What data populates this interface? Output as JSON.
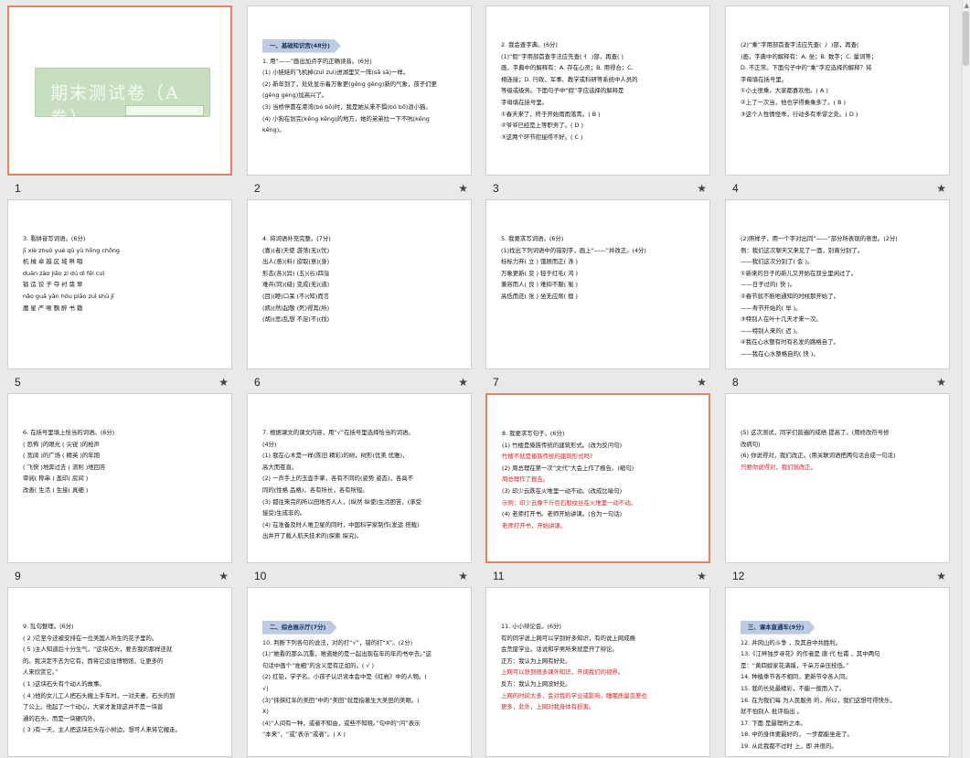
{
  "slides": [
    {
      "num": "1",
      "selected": true,
      "title_text": "期末测试卷（A卷）",
      "lines": []
    },
    {
      "num": "2",
      "header": "一、基础知识宫(48分)",
      "lines": [
        {
          "t": "1. 用“——”画出加点字的正确读音。(6分)"
        },
        {
          "t": "(1) 小娃娃的飞机掉(zuì  zuì)进湖里又一阵(sǎ  sā)一样。"
        },
        {
          "t": "(2) 新年到了，处处显示着万象更(gēng  gèng)新的气象，孩子们更"
        },
        {
          "t": "(gēng  gèng)加高兴了。"
        },
        {
          "t": "(3) 当桥停靠在港湾(bó  bō)时，我是她从来不惧(bó  bō)浪小猫。"
        },
        {
          "t": "(4) 小狗在划完(kēng  kēng)的地方，她的弟弟拉一下不吭(kēng"
        },
        {
          "t": "kēng)。"
        }
      ]
    },
    {
      "num": "3",
      "lines": [
        {
          "t": "2. 我会查字典。(6分)"
        },
        {
          "t": "(1)“假”字用部首查字法应先查(  亻  )部，再查(         )"
        },
        {
          "t": "画，字典中的解释有：A. 存在心灵；B. 用得合；C."
        },
        {
          "t": "相连接；D. 行政、军事、教学或科研等系统中人员的"
        },
        {
          "t": "等级或级务。下面句子中“假”字应选择的解释是"
        },
        {
          "t": "字母填在括号里。"
        },
        {
          "t": "①春天来了，终于开始雨雨落青。(  B  )"
        },
        {
          "t": "②爷爷已经是上等职务了。(  D  )"
        },
        {
          "t": "③这两个环节衔接得不好。(  C  )"
        }
      ]
    },
    {
      "num": "4",
      "lines": [
        {
          "t": "(2)“乘”字用部首查字法应先查(  丿  )部，再查("
        },
        {
          "t": "    )画，字典中的解释有：A. 坐；B. 数字；C. 量词等；"
        },
        {
          "t": "D. 不正常。下面句子中的“乘”字应选择的解释？将"
        },
        {
          "t": "字母填在括号里。"
        },
        {
          "t": "①小土很乘，大家都喜欢他。(  A  )"
        },
        {
          "t": "②上了一次当，他也学得乘乘多了。(  B  )"
        },
        {
          "t": "③这个人性情怪乖，行动多有乖谬之处。(  D  )"
        }
      ]
    },
    {
      "num": "5",
      "lines": [
        {
          "t": "3. 看拼音写词语。(6分)"
        },
        {
          "t": "jī xiè    zhuó yuè    qū yù    hōng chōng"
        },
        {
          "t": "机 械    卓 越    区 域    哄 唱"
        },
        {
          "t": "duàn zào   jiǎo zi    dú dì    fēi cuì"
        },
        {
          "t": "锻 造    饺 子    夺 衬    翡 翠"
        },
        {
          "t": "nǎo guā    yān hóu    piāo zuì    shū jī"
        },
        {
          "t": "魔 星    严 喉    飘 醉    书 籍"
        }
      ]
    },
    {
      "num": "6",
      "lines": [
        {
          "t": "4. 将词语补充完整。(7分)"
        },
        {
          "t": "(喜)(者)天使    游荡(无)(忧)"
        },
        {
          "t": "出人(意)(料)    欲取(意)(身)"
        },
        {
          "t": "形态(各)(异)    (五)(谷)四溢"
        },
        {
          "t": "难兵(同)(级)    变成(无)(道)"
        },
        {
          "t": "(目)(瞪)口呆    (不)(知)而言"
        },
        {
          "t": "(病)(然)起敬    (死)得其(所)"
        },
        {
          "t": "(胡)(思)乱想    不足(不)(找)"
        }
      ]
    },
    {
      "num": "7",
      "lines": [
        {
          "t": "5. 我要求写词语。(6分)"
        },
        {
          "t": "(1)找出下列词语中的错别字，画上“——”并改正。(4分)"
        },
        {
          "t": "标标力弃(  立  )    饿顾而正(  涤  )"
        },
        {
          "t": "万象更新(  变  )    轻于红毛(  鸿  )"
        },
        {
          "t": "兼容而人(  良  )    难抑不服(  冤  )"
        },
        {
          "t": "高低而还(  张  )    坐无应席(  擅  )"
        }
      ]
    },
    {
      "num": "8",
      "lines": [
        {
          "t": "(2)照样子，用一个字对出同“——”部分所表现的意思。(2分)"
        },
        {
          "t": "例：我们这次聊天又来见了一面，别离分别了。"
        },
        {
          "t": "——我们这次分别了(  会  )。"
        },
        {
          "t": "①新来的日子的新儿又开始在双全里闲过了。"
        },
        {
          "t": "——日子过的(  快  )。"
        },
        {
          "t": "②春节就不断地通知的时候那开始了。"
        },
        {
          "t": "——寿节开始的(  早  )。"
        },
        {
          "t": "③特别人在叶十几天才来一次。"
        },
        {
          "t": "——特别人来的(  迟  )。"
        },
        {
          "t": "④我在心水整有时有名发的路格自了。"
        },
        {
          "t": "——我在心水整格自的(  快  )。"
        }
      ]
    },
    {
      "num": "9",
      "lines": [
        {
          "t": "6. 在括号里填上恰当的词语。(6分)"
        },
        {
          "t": "(  恐怖  )的眼光      (  尖锐  )的枪声"
        },
        {
          "t": "(  宽阔  )的广场      (  精英  )的年期"
        },
        {
          "t": "(  飞快  )地奔过去      (  流利  )地回答"
        },
        {
          "t": "审阅(  称串  )      盖印(  房间  )"
        },
        {
          "t": "改善(  生活  )      生接(  真细  )"
        }
      ]
    },
    {
      "num": "10",
      "lines": [
        {
          "t": "7. 根据课文的课文内容，用“√”在括号里选择恰当的词语。"
        },
        {
          "t": "(4分)"
        },
        {
          "t": "(1) 我在心木是一样(陈旧  精彩)的树，树形(优美  优雅)，"
        },
        {
          "t": "高大而苍直。"
        },
        {
          "t": "(2) 一声手上的玉壶手掌，各有不同的(姿势  姿态)，各具不"
        },
        {
          "t": "同的(性格  品格)，各有所长，各有所短。"
        },
        {
          "t": "(3) 都往来完的所以田地否人人，(纵然  纵使)生活困苦，(承受"
        },
        {
          "t": "接受)生成非的。"
        },
        {
          "t": "(4) 在准备及时人难卫星的同时，中国科学家制作(发运  搭载)"
        },
        {
          "t": "出并开了载人航天技术的(探索  探究)。"
        }
      ]
    },
    {
      "num": "11",
      "selected": true,
      "lines": [
        {
          "t": "8. 我要求写句子。(6分)"
        },
        {
          "t": "(1) 竹楼是傣族传统的建筑形式。(改为反问句)"
        },
        {
          "t": "竹楼不就是傣族传统的建筑形式吗?",
          "c": "red"
        },
        {
          "t": "(2) 周总理在第一次“文代”大会上作了报告。(缩句)"
        },
        {
          "t": "周总理作了报告。",
          "c": "red"
        },
        {
          "t": "(3) 印少云跌在火堆里一动不动。(改成比喻句)"
        },
        {
          "t": "示例：印少云像千斤巨石般纹丝在火堆里一动不动。",
          "c": "red"
        },
        {
          "t": "(4) 老师打开书。老师开始讲课。(合为一句话)"
        },
        {
          "t": "老师打开书，开始讲课。",
          "c": "red"
        }
      ]
    },
    {
      "num": "12",
      "lines": [
        {
          "t": ""
        },
        {
          "t": ""
        },
        {
          "t": "(5) 这次测试，同学们普遍的成绩 提高了。(用修改符号修"
        },
        {
          "t": "改病句)"
        },
        {
          "t": "(6) 你说得对，我们改正。(用关联词语把两句话合成一句话)"
        },
        {
          "t": "只要你说得对，我们就改正。",
          "c": "red"
        }
      ]
    },
    {
      "num": "13",
      "lines": [
        {
          "t": "9. 乱句整理。(6分)"
        },
        {
          "t": "(  2  )它至今还被安排在一位美国人所生的花子里的。"
        },
        {
          "t": "(  5  )主人知道后十分生气，“这块石头，要去我的那样还就"
        },
        {
          "t": "的。我决定不去为它有，而将它运往博物馆，让更多的"
        },
        {
          "t": "人来欣赏它。”"
        },
        {
          "t": "(  1  )这块石头有个动人的故事。"
        },
        {
          "t": "(  4  )他的女儿工人把石头搬上手车时，一对夫妻，石头的到"
        },
        {
          "t": "了公上。他起了一个动心，大家才发现这并不是一块普"
        },
        {
          "t": "通的石头，而是一块硬内外。"
        },
        {
          "t": "(  3  )有一天，主人把这块石头在小树边，想可人来将它搬走。"
        }
      ]
    },
    {
      "num": "14",
      "header": "二、综合展示厅(7分)",
      "lines": [
        {
          "t": "10. 判断下列各句的说法，对的打“√”，错的打“X”。(2分)"
        },
        {
          "t": "(1)“她看的那么沉重，难道她的是一起出现在年的年的书中去。”这"
        },
        {
          "t": "句话中画个“准细”的含义是有正如的。(  √  )"
        },
        {
          "t": "(2) 红铅，学子名。小孩子认识读本会中是《红岩》中的人物。("
        },
        {
          "t": "√)"
        },
        {
          "t": "(3)“抹抹红年的美田”中的“美田”就是指著生大美田的美眼。("
        },
        {
          "t": "X)"
        },
        {
          "t": "(4)“人间有一种，或者不知由，或些不知晓。”句中的“问”表示"
        },
        {
          "t": "“本来”，“或”表示“或者”。(  X  )"
        }
      ]
    },
    {
      "num": "15",
      "lines": [
        {
          "t": "11. 小小辩论会。(6分)"
        },
        {
          "t": "有的同学说上网可以学到好多知识，有的说上网成瘾"
        },
        {
          "t": "会荒废学业。话说和学男所来就是开了辩论。"
        },
        {
          "t": "    正方：我认为上网有好处。"
        },
        {
          "t": "上网可以获到很多课外知识，开阔我们的视界。",
          "c": "red"
        },
        {
          "t": ""
        },
        {
          "t": "    反方：我认为上网没好处。"
        },
        {
          "t": "上网的时间太多，会对我的学业或影响，睡眠质量变差也",
          "c": "red"
        },
        {
          "t": "更多，此外，上网对我身体有损害。",
          "c": "red"
        }
      ]
    },
    {
      "num": "16",
      "header": "三、课本直通车(9分)",
      "lines": [
        {
          "t": "12. 井冈山的斗争 ，及其自中共胜利。",
          "hl": "red"
        },
        {
          "t": "13.《江畔独步寻花》的作者是  唐  代  杜甫  ，其中两句"
        },
        {
          "t": "是：“黄四娘家花满蹊，千朵万朵压枝低。”"
        },
        {
          "t": "14. 种植季节各不相同，更新节令各人同。"
        },
        {
          "t": "15. 我的长处最精彩，不能一般而入了。"
        },
        {
          "t": "16. 在为我们每  为人民服务  的，所以，我们这想可得快乐，"
        },
        {
          "t": "就不怕别人  批评指出  。"
        },
        {
          "t": "17.  下面  是最理所之本。"
        },
        {
          "t": "18. 中的身体要最好的，  一步都能坐走了。"
        },
        {
          "t": "19. 从此我都不过时  上，即  并很的。"
        }
      ]
    }
  ],
  "colors": {
    "selected_border": "#e8825a",
    "answer_red": "#e02020",
    "header_blue": "#bccbe2",
    "title_green": "#c7dfc0"
  },
  "star_icon": "★",
  "scroll_icon": "▲"
}
